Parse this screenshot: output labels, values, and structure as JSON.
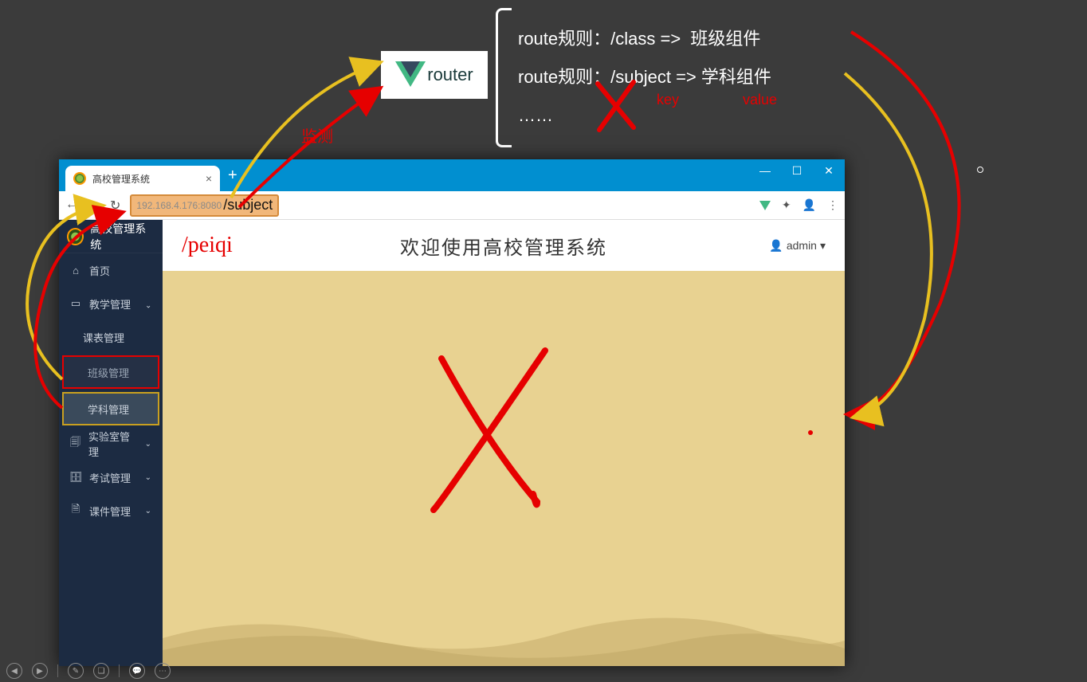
{
  "router": {
    "label": "router",
    "rules": [
      "route规则：/class =>  班级组件",
      "route规则：/subject => 学科组件",
      "……"
    ],
    "key_label": "key",
    "value_label": "value"
  },
  "monitor_label": "监测",
  "browser": {
    "tab_title": "高校管理系统",
    "url_host": "192.168.4.176:8080",
    "url_path": "/subject"
  },
  "app": {
    "brand": "高校管理系统",
    "welcome": "欢迎使用高校管理系统",
    "annotation_path": "/peiqi",
    "user": "admin",
    "sidebar": {
      "home": "首页",
      "teach": "教学管理",
      "schedule": "课表管理",
      "class": "班级管理",
      "subject": "学科管理",
      "lab": "实验室管理",
      "exam": "考试管理",
      "courseware": "课件管理"
    }
  }
}
